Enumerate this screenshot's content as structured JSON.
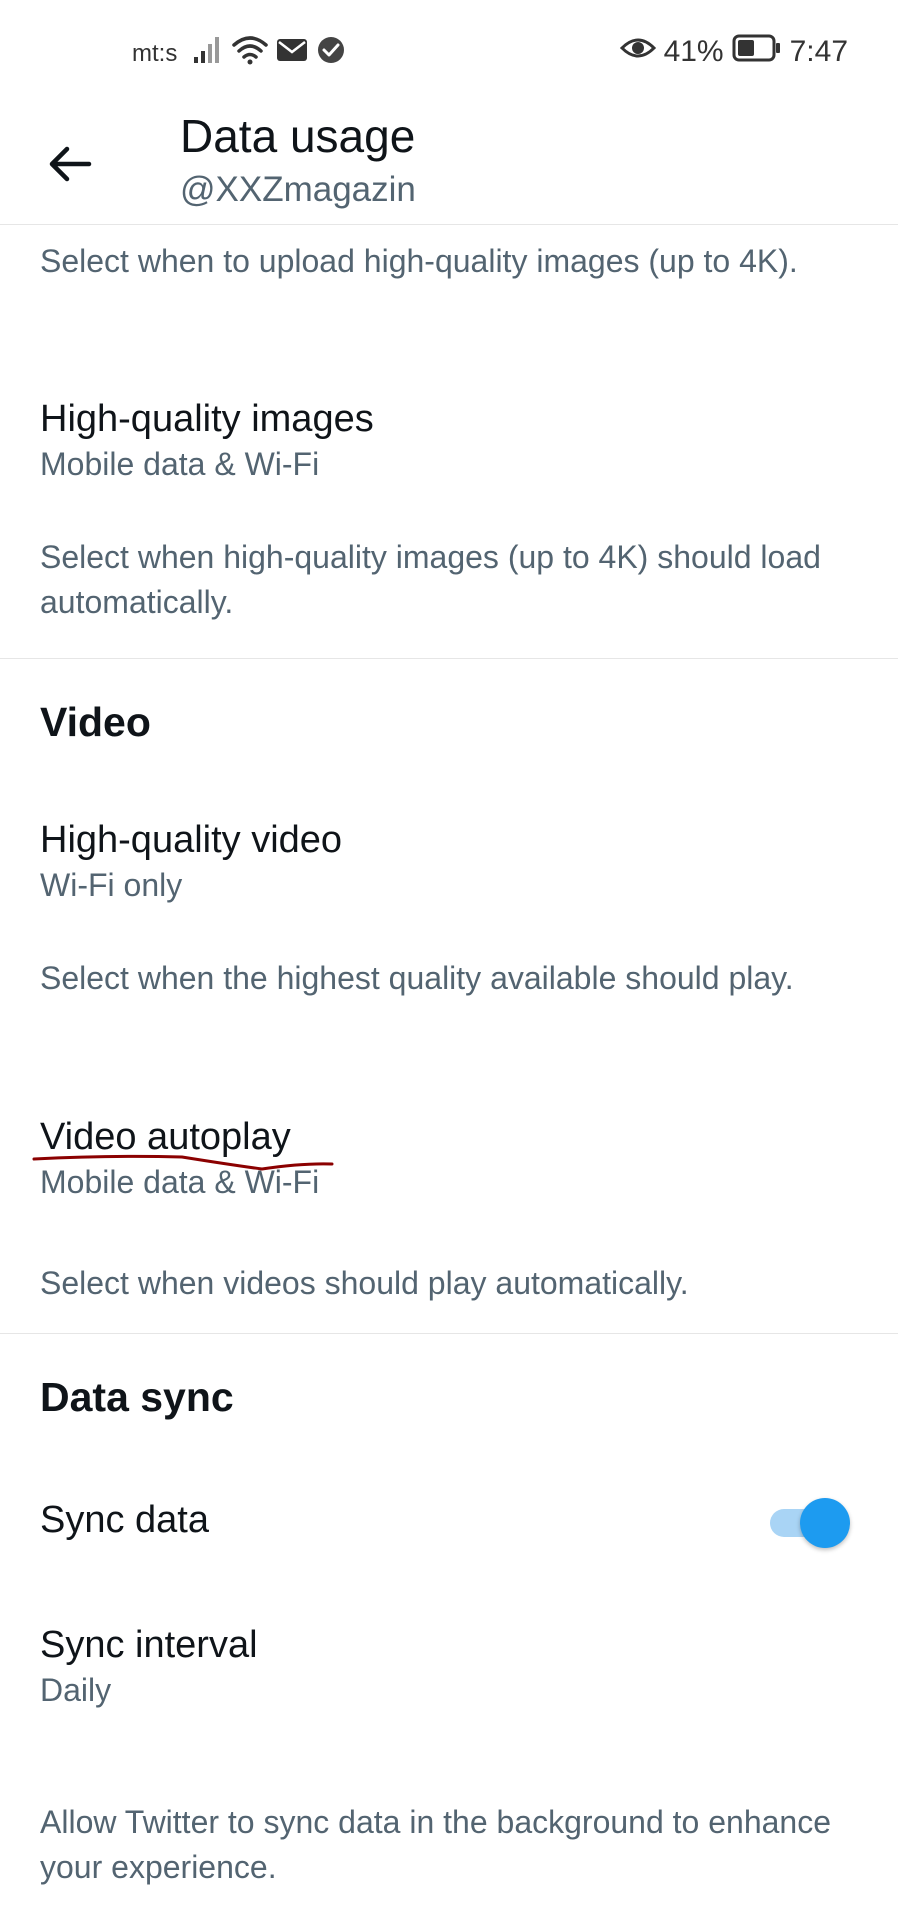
{
  "status_bar": {
    "carrier": "mt:s",
    "battery_percent": "41%",
    "time": "7:47",
    "icons_left": [
      "signal-icon",
      "wifi-icon",
      "mail-icon",
      "check-circle-icon"
    ],
    "icons_right": [
      "eye-icon",
      "battery-icon"
    ]
  },
  "header": {
    "title": "Data usage",
    "subtitle": "@XXZmagazin",
    "back_icon": "arrow-left-icon"
  },
  "images": {
    "upload_description": "Select when to upload high-quality images (up to 4K).",
    "high_quality_images": {
      "title": "High-quality images",
      "value": "Mobile data & Wi-Fi",
      "description": "Select when high-quality images (up to 4K) should load automatically."
    }
  },
  "video": {
    "heading": "Video",
    "high_quality_video": {
      "title": "High-quality video",
      "value": "Wi-Fi only",
      "description": "Select when the highest quality available should play."
    },
    "video_autoplay": {
      "title": "Video autoplay",
      "value": "Mobile data & Wi-Fi",
      "description": "Select when videos should play automatically."
    },
    "annotation_color": "#8b0000"
  },
  "data_sync": {
    "heading": "Data sync",
    "sync_data": {
      "title": "Sync data",
      "toggle_on": true,
      "toggle_color": "#1d9bf0"
    },
    "sync_interval": {
      "title": "Sync interval",
      "value": "Daily",
      "description": "Allow Twitter to sync data in the background to enhance your experience."
    }
  }
}
